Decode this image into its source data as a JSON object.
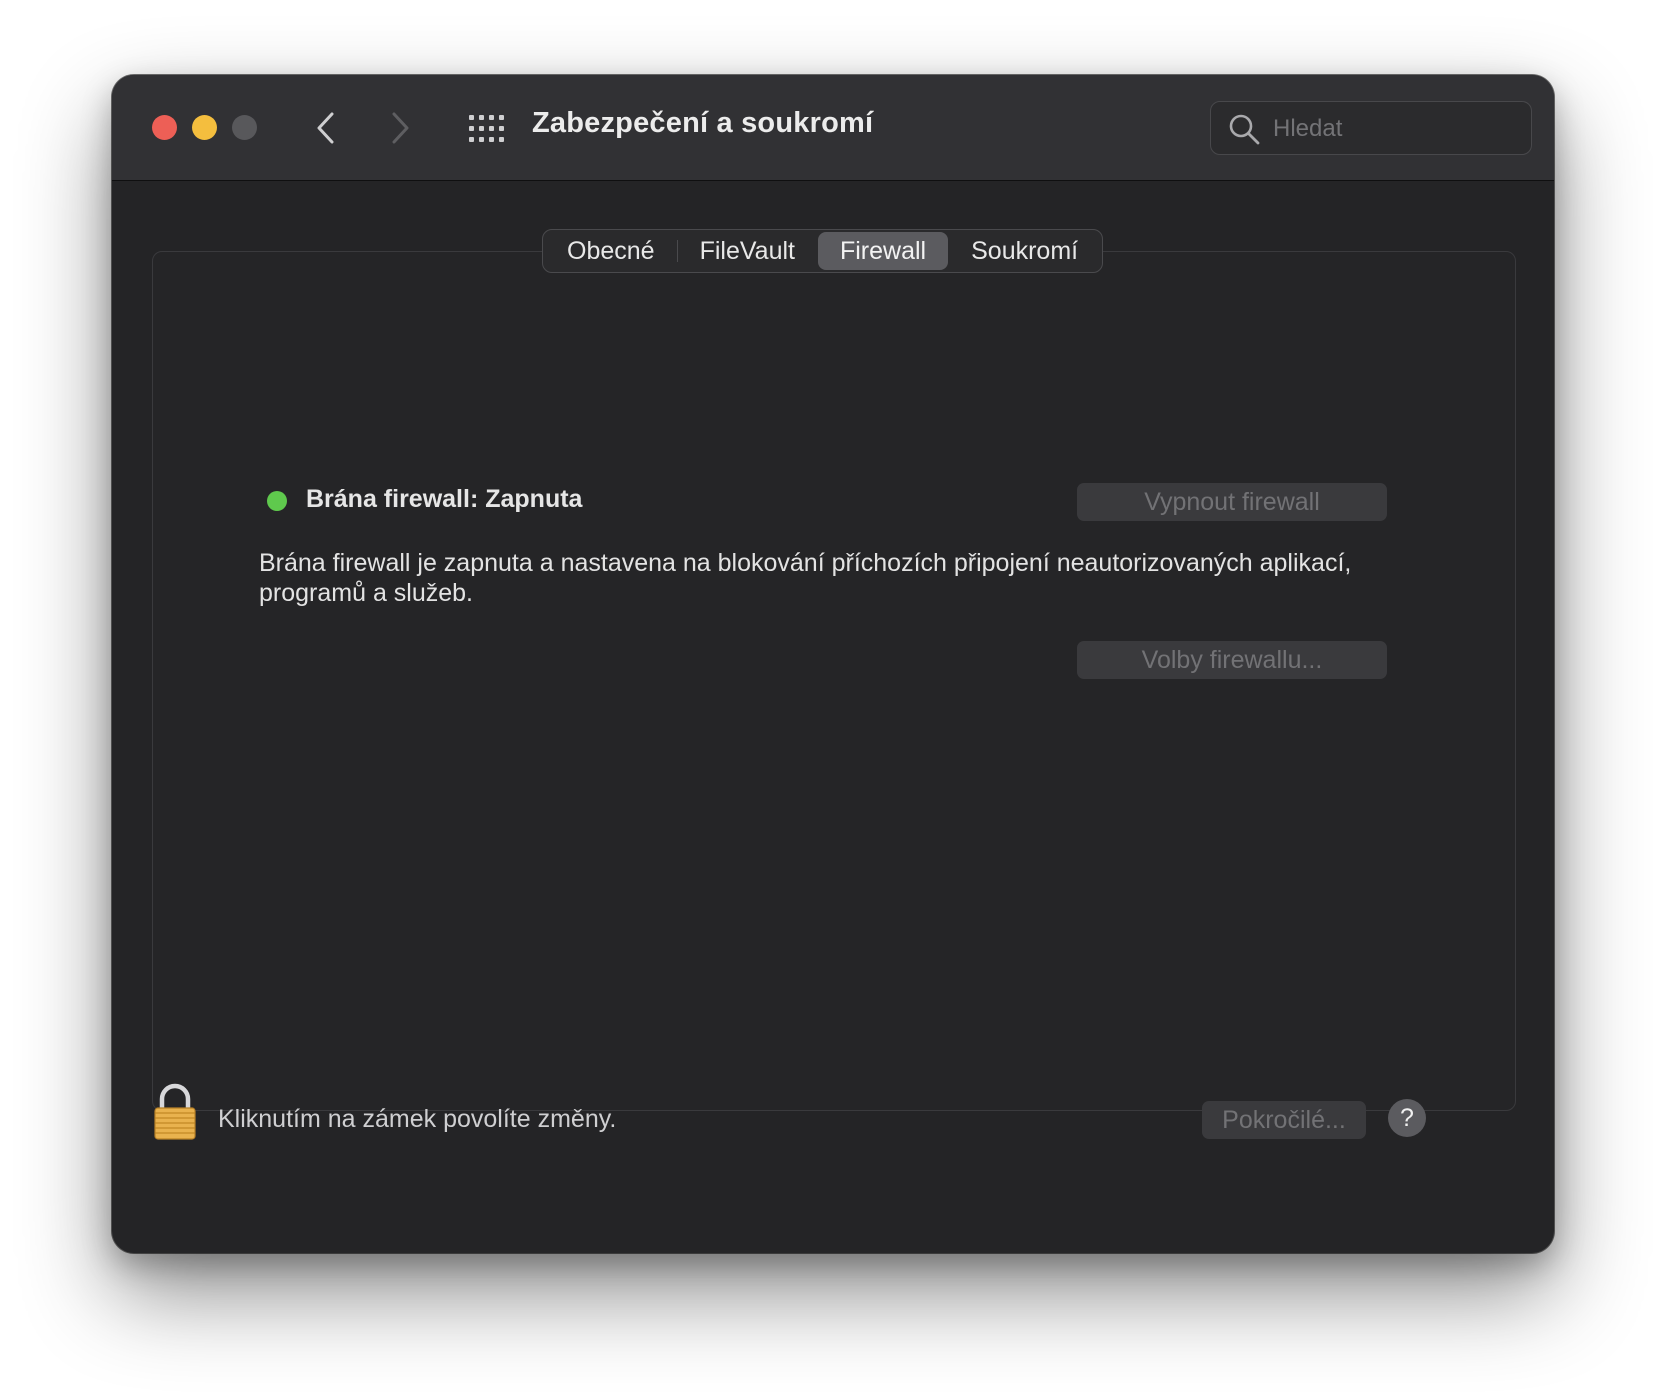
{
  "window": {
    "title": "Zabezpečení a soukromí"
  },
  "toolbar": {
    "back_icon": "chevron-left-icon",
    "forward_icon": "chevron-right-icon",
    "show_all_icon": "grid-icon"
  },
  "search": {
    "placeholder": "Hledat",
    "value": ""
  },
  "tabs": [
    {
      "label": "Obecné",
      "active": false
    },
    {
      "label": "FileVault",
      "active": false
    },
    {
      "label": "Firewall",
      "active": true
    },
    {
      "label": "Soukromí",
      "active": false
    }
  ],
  "firewall": {
    "status": "Brána firewall: Zapnuta",
    "status_color": "#5fc94d",
    "turn_off_label": "Vypnout firewall",
    "description": "Brána firewall je zapnuta a nastavena na blokování příchozích připojení neautorizovaných aplikací, programů a služeb.",
    "options_label": "Volby firewallu..."
  },
  "footer": {
    "lock_text": "Kliknutím na zámek povolíte změny.",
    "advanced_label": "Pokročilé...",
    "help_label": "?"
  },
  "colors": {
    "close": "#ed5f56",
    "minimize": "#f4be3e",
    "zoom_disabled": "#58585b",
    "window_bg": "#242426"
  }
}
